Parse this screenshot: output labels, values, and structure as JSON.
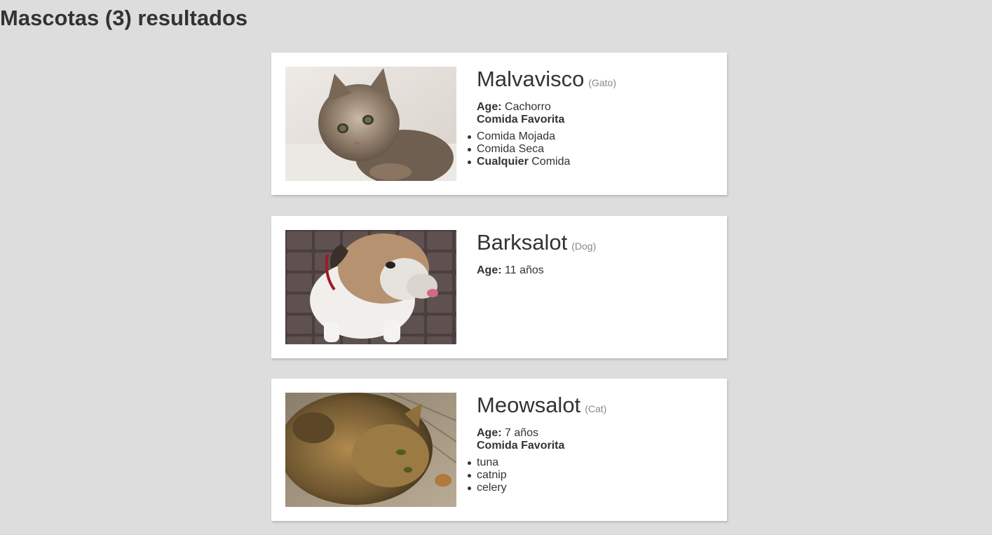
{
  "page": {
    "title": "Mascotas (3) resultados"
  },
  "labels": {
    "age": "Age:",
    "favorite_food": "Comida Favorita"
  },
  "pets": [
    {
      "name": "Malvavisco",
      "type": "(Gato)",
      "age": "Cachorro",
      "foods": [
        {
          "bold": "",
          "text": "Comida Mojada"
        },
        {
          "bold": "",
          "text": "Comida Seca"
        },
        {
          "bold": "Cualquier",
          "text": " Comida"
        }
      ],
      "photo": "kitten-photo"
    },
    {
      "name": "Barksalot",
      "type": "(Dog)",
      "age": "11 años",
      "foods": [],
      "photo": "bulldog-photo"
    },
    {
      "name": "Meowsalot",
      "type": "(Cat)",
      "age": "7 años",
      "foods": [
        {
          "bold": "",
          "text": "tuna"
        },
        {
          "bold": "",
          "text": "catnip"
        },
        {
          "bold": "",
          "text": "celery"
        }
      ],
      "photo": "tabby-cat-photo"
    }
  ],
  "colors": {
    "background": "#dddddd",
    "card": "#ffffff",
    "text": "#333333",
    "muted": "#888888"
  }
}
